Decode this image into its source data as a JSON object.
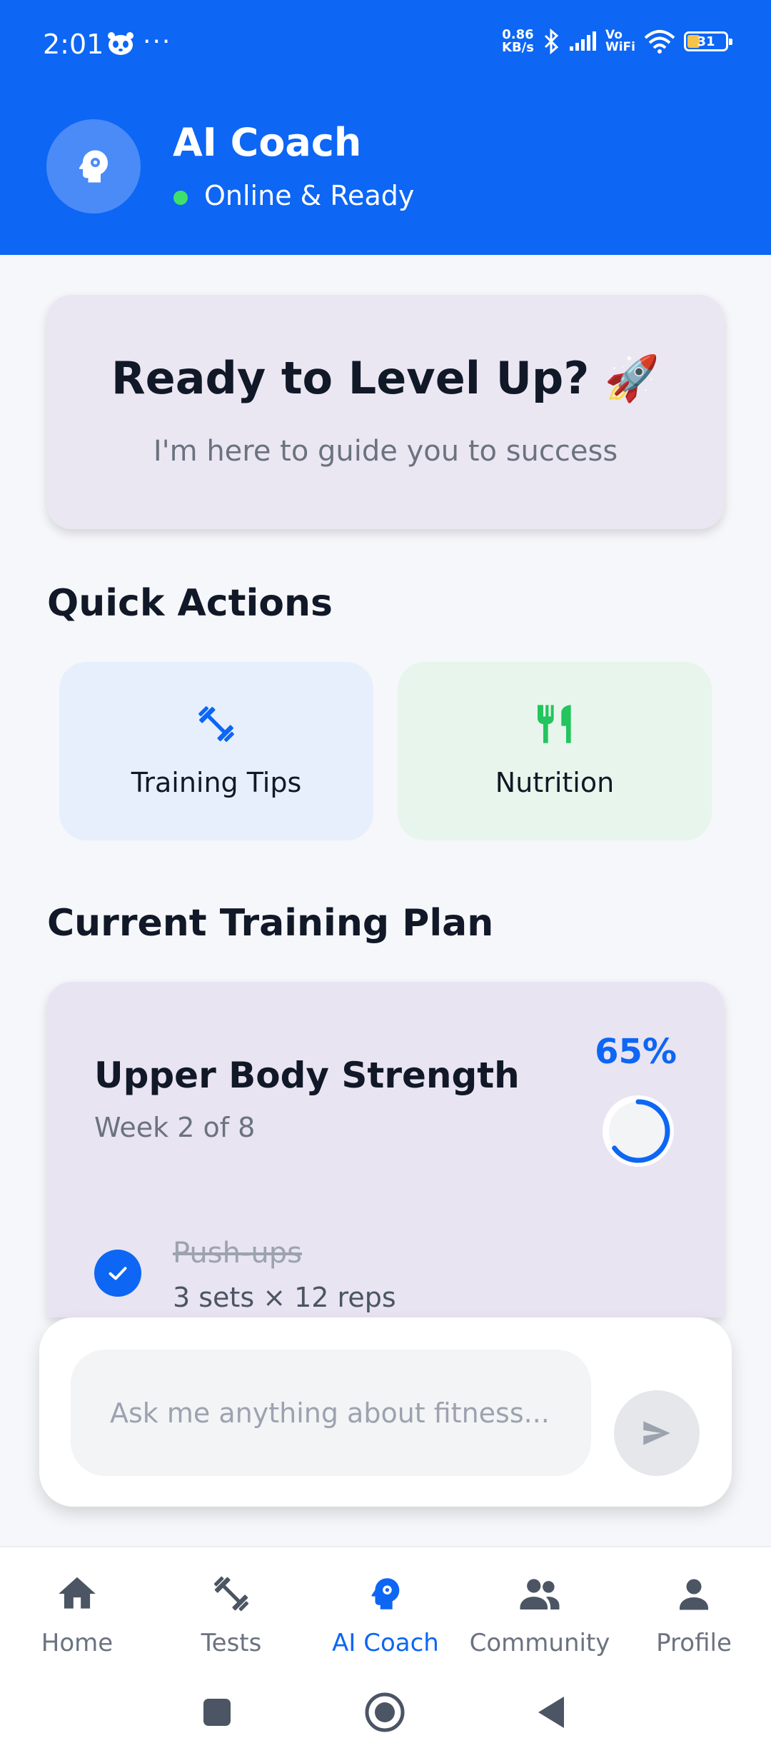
{
  "status_bar": {
    "time": "2:01",
    "dots": "···",
    "net_speed_value": "0.86",
    "net_speed_unit": "KB/s",
    "vowifi_top": "Vo",
    "vowifi_bottom": "WiFi",
    "battery": "31"
  },
  "header": {
    "title": "AI Coach",
    "status": "Online & Ready",
    "avatar_icon": "brain-head-icon"
  },
  "hero": {
    "title": "Ready to Level Up? 🚀",
    "subtitle": "I'm here to guide you to success"
  },
  "quick_actions": {
    "title": "Quick Actions",
    "items": [
      {
        "label": "Training Tips",
        "icon": "dumbbell-icon",
        "color": "#0d66f4"
      },
      {
        "label": "Nutrition",
        "icon": "fork-knife-icon",
        "color": "#22c55e"
      }
    ]
  },
  "plan": {
    "section_title": "Current Training Plan",
    "name": "Upper Body Strength",
    "week": "Week 2 of 8",
    "progress_label": "65%",
    "progress": 0.65,
    "exercises": [
      {
        "name": "Push-ups",
        "detail": "3 sets × 12 reps",
        "done": true
      }
    ]
  },
  "chat": {
    "placeholder": "Ask me anything about fitness..."
  },
  "bottom_nav": {
    "items": [
      {
        "label": "Home",
        "icon": "home-icon",
        "active": false
      },
      {
        "label": "Tests",
        "icon": "dumbbell-icon",
        "active": false
      },
      {
        "label": "AI Coach",
        "icon": "brain-head-icon",
        "active": true
      },
      {
        "label": "Community",
        "icon": "people-icon",
        "active": false
      },
      {
        "label": "Profile",
        "icon": "person-icon",
        "active": false
      }
    ]
  },
  "colors": {
    "primary": "#0d66f4",
    "online": "#3ee06b",
    "nutrition": "#22c55e"
  }
}
